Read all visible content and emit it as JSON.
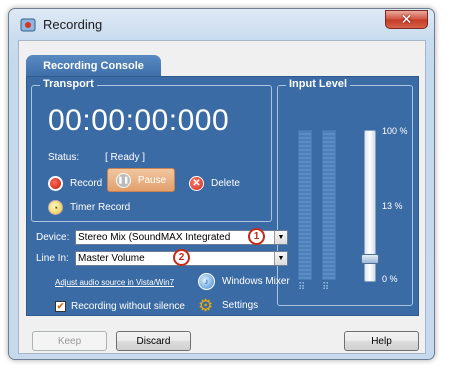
{
  "window": {
    "title": "Recording",
    "close_glyph": "✕"
  },
  "tab": {
    "label": "Recording Console"
  },
  "transport": {
    "label": "Transport",
    "time": "00:00:00:000",
    "status_label": "Status:",
    "status_value": "[ Ready ]",
    "record_label": "Record",
    "pause_label": "Pause",
    "delete_label": "Delete",
    "timer_label": "Timer Record"
  },
  "input_level": {
    "label": "Input Level",
    "top_label": "100 %",
    "mid_label": "13 %",
    "bottom_label": "0 %",
    "level_fraction": 0.13
  },
  "device": {
    "label": "Device:",
    "value": "Stereo Mix (SoundMAX Integrated",
    "badge": "1"
  },
  "line_in": {
    "label": "Line In:",
    "value": "Master Volume",
    "badge": "2"
  },
  "links": {
    "adjust": "Adjust audio source in Vista/Win7"
  },
  "mixer": {
    "label": "Windows Mixer"
  },
  "recording_silence": {
    "label": "Recording without silence",
    "checked": true
  },
  "settings": {
    "label": "Settings"
  },
  "buttons": {
    "keep": "Keep",
    "discard": "Discard",
    "help": "Help"
  }
}
